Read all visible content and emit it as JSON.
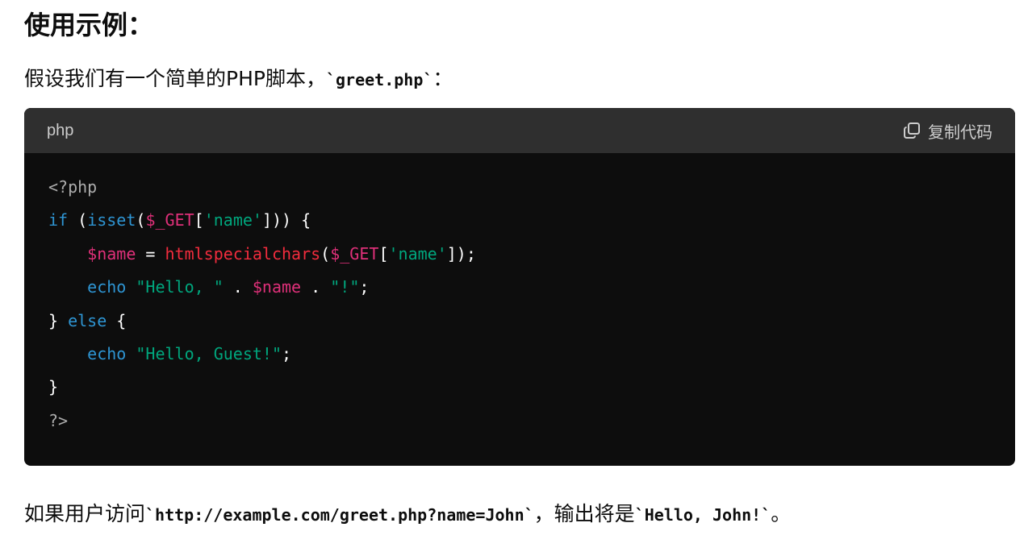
{
  "heading": "使用示例：",
  "intro": {
    "text": "假设我们有一个简单的PHP脚本，",
    "code": "`greet.php`",
    "suffix": "："
  },
  "code_block": {
    "language": "php",
    "copy_label": "复制代码",
    "copy_icon": "copy-icon",
    "lines": [
      [
        {
          "t": "<?php",
          "c": "meta"
        }
      ],
      [
        {
          "t": "if",
          "c": "kw"
        },
        {
          "t": " (",
          "c": "plain"
        },
        {
          "t": "isset",
          "c": "fn"
        },
        {
          "t": "(",
          "c": "plain"
        },
        {
          "t": "$_GET",
          "c": "var"
        },
        {
          "t": "[",
          "c": "plain"
        },
        {
          "t": "'name'",
          "c": "str"
        },
        {
          "t": "])) {",
          "c": "plain"
        }
      ],
      [
        {
          "t": "    ",
          "c": "plain"
        },
        {
          "t": "$name",
          "c": "var"
        },
        {
          "t": " = ",
          "c": "plain"
        },
        {
          "t": "htmlspecialchars",
          "c": "call"
        },
        {
          "t": "(",
          "c": "plain"
        },
        {
          "t": "$_GET",
          "c": "var"
        },
        {
          "t": "[",
          "c": "plain"
        },
        {
          "t": "'name'",
          "c": "str"
        },
        {
          "t": "]);",
          "c": "plain"
        }
      ],
      [
        {
          "t": "    ",
          "c": "plain"
        },
        {
          "t": "echo",
          "c": "kw"
        },
        {
          "t": " ",
          "c": "plain"
        },
        {
          "t": "\"Hello, \"",
          "c": "str"
        },
        {
          "t": " . ",
          "c": "plain"
        },
        {
          "t": "$name",
          "c": "var"
        },
        {
          "t": " . ",
          "c": "plain"
        },
        {
          "t": "\"!\"",
          "c": "str"
        },
        {
          "t": ";",
          "c": "plain"
        }
      ],
      [
        {
          "t": "} ",
          "c": "plain"
        },
        {
          "t": "else",
          "c": "kw"
        },
        {
          "t": " {",
          "c": "plain"
        }
      ],
      [
        {
          "t": "    ",
          "c": "plain"
        },
        {
          "t": "echo",
          "c": "kw"
        },
        {
          "t": " ",
          "c": "plain"
        },
        {
          "t": "\"Hello, Guest!\"",
          "c": "str"
        },
        {
          "t": ";",
          "c": "plain"
        }
      ],
      [
        {
          "t": "}",
          "c": "plain"
        }
      ],
      [
        {
          "t": "?>",
          "c": "meta"
        }
      ]
    ]
  },
  "outro": {
    "text1": "如果用户访问",
    "code1": "`http://example.com/greet.php?name=John`",
    "text2": "，输出将是",
    "code2": "`Hello, John!`",
    "text3": "。"
  },
  "colors": {
    "code_bg": "#0d0d0d",
    "header_bg": "#2f2f2f",
    "keyword": "#2e95d3",
    "variable": "#df3079",
    "string": "#00a67d",
    "function_call": "#f22c3d",
    "meta": "#acacac"
  }
}
